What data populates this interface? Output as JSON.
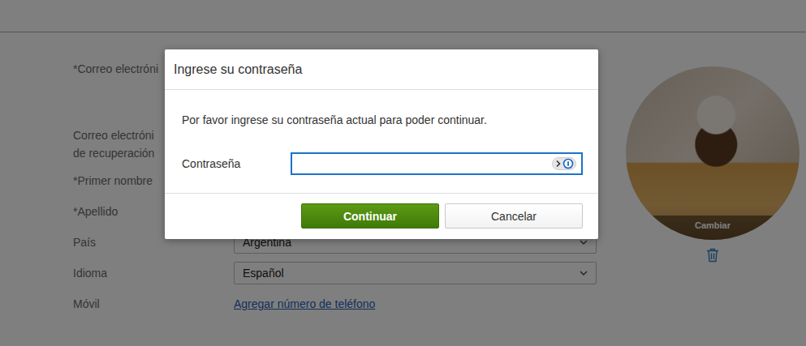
{
  "page": {
    "fields": [
      {
        "lines": [
          "*Correo electróni"
        ],
        "kind": "text",
        "value": ""
      },
      {
        "lines": [
          "Correo electróni",
          "de recuperación"
        ],
        "kind": "text",
        "value": ""
      },
      {
        "lines": [
          "*Primer nombre"
        ],
        "kind": "text",
        "value": ""
      },
      {
        "lines": [
          "*Apellido"
        ],
        "kind": "text",
        "value": ""
      },
      {
        "lines": [
          "País"
        ],
        "kind": "select",
        "value": "Argentina"
      },
      {
        "lines": [
          "Idioma"
        ],
        "kind": "select",
        "value": "Español"
      },
      {
        "lines": [
          "Móvil"
        ],
        "kind": "link",
        "value": "Agregar número de teléfono"
      }
    ],
    "avatar": {
      "button": "Cambiar"
    }
  },
  "dialog": {
    "title": "Ingrese su contraseña",
    "message": "Por favor ingrese su contraseña actual para poder continuar.",
    "field": {
      "label": "Contraseña",
      "value": "",
      "focused": true
    },
    "buttons": [
      {
        "label": "Continuar",
        "primary": true
      },
      {
        "label": "Cancelar",
        "primary": false
      }
    ]
  }
}
